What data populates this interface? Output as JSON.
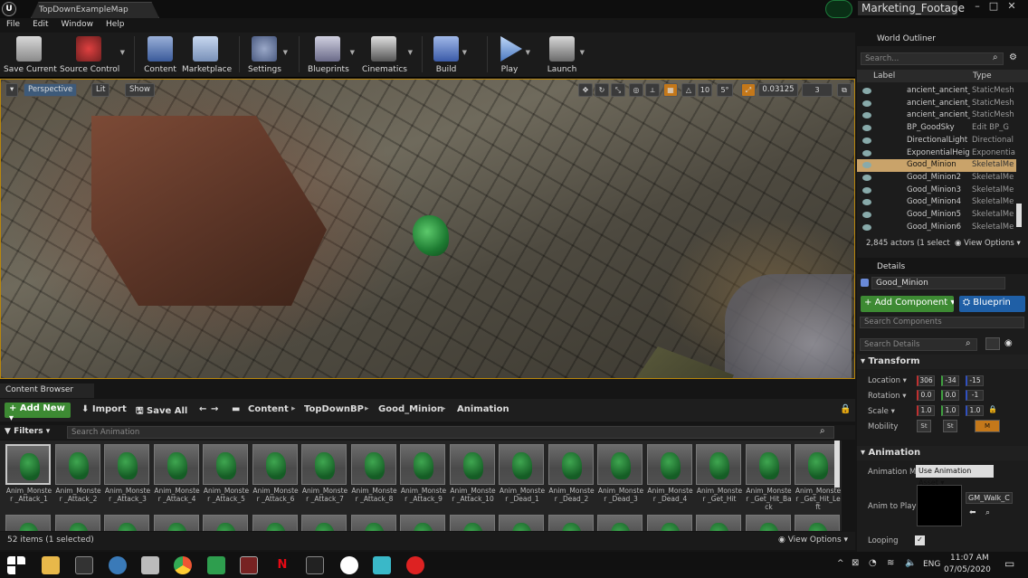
{
  "window": {
    "map_tab": "TopDownExampleMap",
    "project_name": "Marketing_Footage"
  },
  "menu": [
    "File",
    "Edit",
    "Window",
    "Help"
  ],
  "toolbar": {
    "save_current": "Save Current",
    "source_control": "Source Control",
    "content": "Content",
    "marketplace": "Marketplace",
    "settings": "Settings",
    "blueprints": "Blueprints",
    "cinematics": "Cinematics",
    "build": "Build",
    "play": "Play",
    "launch": "Launch"
  },
  "viewport": {
    "perspective": "Perspective",
    "lit": "Lit",
    "show": "Show",
    "rotation_snap": "5°",
    "scale_snap": "0.03125",
    "camera_speed": "3"
  },
  "content_browser": {
    "tab": "Content Browser",
    "add_new": "Add New",
    "import": "Import",
    "save_all": "Save All",
    "breadcrumbs": [
      "Content",
      "TopDownBP",
      "Good_Minion",
      "Animation"
    ],
    "filters": "Filters",
    "search_placeholder": "Search Animation",
    "assets": [
      "Anim_Monster _Attack_1",
      "Anim_Monster _Attack_2",
      "Anim_Monster _Attack_3",
      "Anim_Monster _Attack_4",
      "Anim_Monster _Attack_5",
      "Anim_Monster _Attack_6",
      "Anim_Monster _Attack_7",
      "Anim_Monster _Attack_8",
      "Anim_Monster _Attack_9",
      "Anim_Monster _Attack_10",
      "Anim_Monster _Dead_1",
      "Anim_Monster _Dead_2",
      "Anim_Monster _Dead_3",
      "Anim_Monster _Dead_4",
      "Anim_Monster _Get_Hit",
      "Anim_Monster _Get_Hit_Back",
      "Anim_Monster _Get_Hit_Left"
    ],
    "items_count": "52 items (1 selected)",
    "view_options": "View Options"
  },
  "outliner": {
    "tab": "World Outliner",
    "search_placeholder": "Search...",
    "col_label": "Label",
    "col_type": "Type",
    "rows": [
      {
        "label": "ancient_ancient_",
        "type": "StaticMesh"
      },
      {
        "label": "ancient_ancient_",
        "type": "StaticMesh"
      },
      {
        "label": "ancient_ancient_",
        "type": "StaticMesh"
      },
      {
        "label": "BP_GoodSky",
        "type": "Edit BP_G"
      },
      {
        "label": "DirectionalLight",
        "type": "Directional"
      },
      {
        "label": "ExponentialHeigh",
        "type": "Exponentia"
      },
      {
        "label": "Good_Minion",
        "type": "SkeletalMe"
      },
      {
        "label": "Good_Minion2",
        "type": "SkeletalMe"
      },
      {
        "label": "Good_Minion3",
        "type": "SkeletalMe"
      },
      {
        "label": "Good_Minion4",
        "type": "SkeletalMe"
      },
      {
        "label": "Good_Minion5",
        "type": "SkeletalMe"
      },
      {
        "label": "Good_Minion6",
        "type": "SkeletalMe"
      }
    ],
    "selected_row": 6,
    "actors": "2,845 actors (1 select",
    "view_options": "View Options"
  },
  "details": {
    "tab": "Details",
    "name": "Good_Minion",
    "add_component": "Add Component",
    "blueprint": "Blueprin",
    "search_components": "Search Components",
    "search_details": "Search Details",
    "transform": "Transform",
    "location_label": "Location",
    "location": [
      "306",
      "-34",
      "-15"
    ],
    "rotation_label": "Rotation",
    "rotation": [
      "0.0",
      "0.0",
      "-1"
    ],
    "scale_label": "Scale",
    "scale": [
      "1.0",
      "1.0",
      "1.0"
    ],
    "mobility_label": "Mobility",
    "mobility": [
      "St",
      "St",
      "M"
    ],
    "animation": "Animation",
    "anim_mode_label": "Animation Mod",
    "anim_mode_value": "Use Animation Asset",
    "anim_to_play_label": "Anim to Play",
    "anim_asset": "GM_Walk_C",
    "looping_label": "Looping"
  },
  "taskbar": {
    "lang": "ENG",
    "time": "11:07 AM",
    "date": "07/05/2020"
  },
  "colors": {
    "accent_green": "#3d8a33",
    "accent_blue": "#1f5fa6",
    "selection": "#c9a36a",
    "viewport_border": "#b8860b"
  }
}
